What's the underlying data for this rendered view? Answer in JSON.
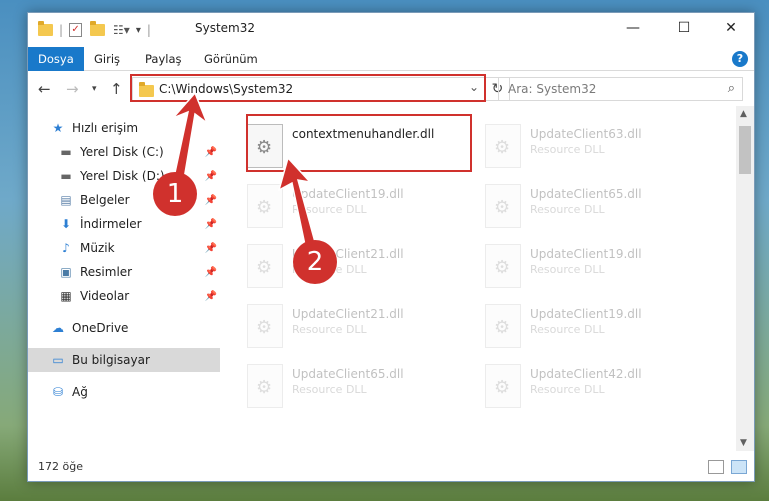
{
  "window": {
    "title": "System32",
    "controls": {
      "minimize": "—",
      "maximize": "☐",
      "close": "✕"
    }
  },
  "ribbon": {
    "tabs": [
      {
        "label": "Dosya",
        "active": true
      },
      {
        "label": "Giriş"
      },
      {
        "label": "Paylaş"
      },
      {
        "label": "Görünüm"
      }
    ],
    "help": "?"
  },
  "navigation": {
    "address": "C:\\Windows\\System32",
    "search_placeholder": "Ara: System32"
  },
  "sidebar": {
    "items": [
      {
        "label": "Hızlı erişim",
        "icon": "star-icon",
        "pinned": false
      },
      {
        "label": "Yerel Disk (C:)",
        "icon": "drive-icon",
        "pinned": true
      },
      {
        "label": "Yerel Disk (D:)",
        "icon": "drive-icon",
        "pinned": true
      },
      {
        "label": "Belgeler",
        "icon": "document-icon",
        "pinned": true
      },
      {
        "label": "İndirmeler",
        "icon": "download-icon",
        "pinned": true
      },
      {
        "label": "Müzik",
        "icon": "music-icon",
        "pinned": true
      },
      {
        "label": "Resimler",
        "icon": "pictures-icon",
        "pinned": true
      },
      {
        "label": "Videolar",
        "icon": "video-icon",
        "pinned": true
      },
      {
        "label": "OneDrive",
        "icon": "cloud-icon",
        "pinned": false
      },
      {
        "label": "Bu bilgisayar",
        "icon": "computer-icon",
        "pinned": false,
        "selected": true
      },
      {
        "label": "Ağ",
        "icon": "network-icon",
        "pinned": false
      }
    ]
  },
  "files": {
    "highlighted": {
      "name": "contextmenuhandler.dll"
    },
    "left_column": [
      {
        "name": "UpdateClient19.dll",
        "type": "Resource DLL"
      },
      {
        "name": "UpdateClient21.dll",
        "type": "Resource DLL"
      },
      {
        "name": "UpdateClient21.dll",
        "type": "Resource DLL"
      },
      {
        "name": "UpdateClient65.dll",
        "type": "Resource DLL"
      }
    ],
    "right_column": [
      {
        "name": "UpdateClient63.dll",
        "type": "Resource DLL"
      },
      {
        "name": "UpdateClient65.dll",
        "type": "Resource DLL"
      },
      {
        "name": "UpdateClient19.dll",
        "type": "Resource DLL"
      },
      {
        "name": "UpdateClient19.dll",
        "type": "Resource DLL"
      },
      {
        "name": "UpdateClient42.dll",
        "type": "Resource DLL"
      }
    ]
  },
  "status": {
    "item_count": "172 öğe"
  },
  "annotations": {
    "step1": "1",
    "step2": "2",
    "accent_color": "#d0312d"
  }
}
